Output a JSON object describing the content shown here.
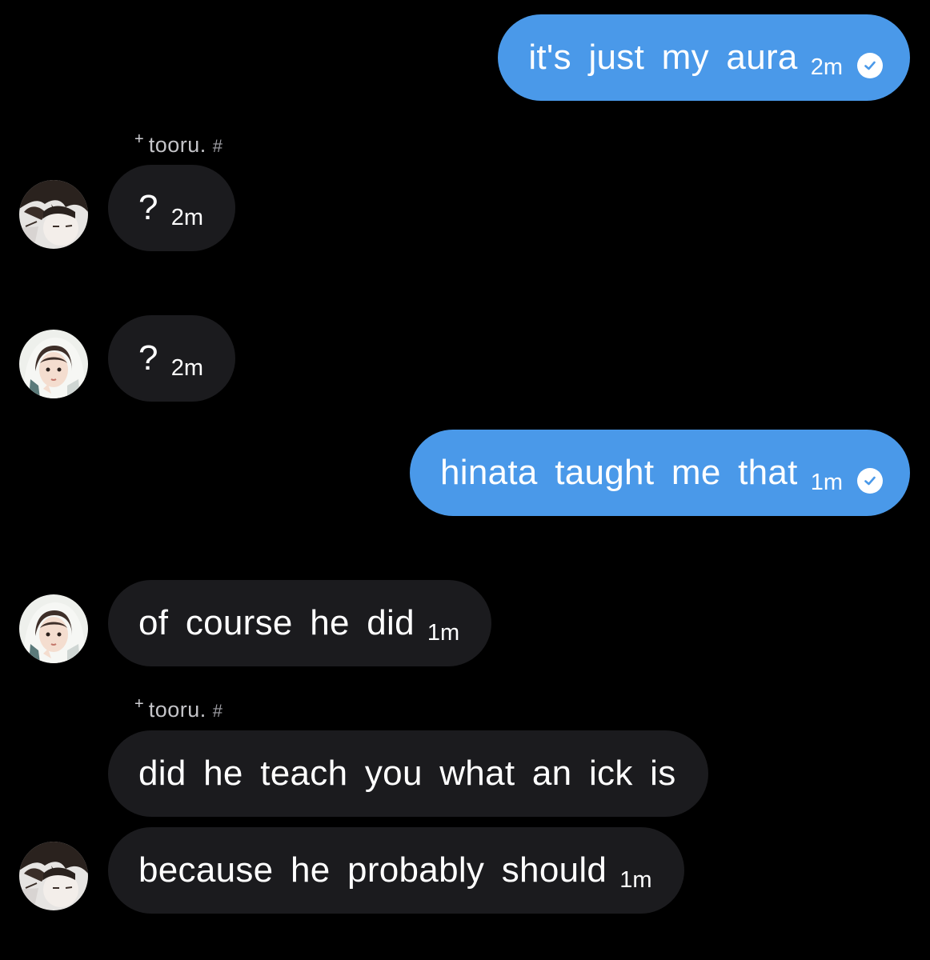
{
  "messages": [
    {
      "id": "m1",
      "direction": "outgoing",
      "text": "it's just my aura",
      "time": "2m",
      "read_icon": "check-circle-icon"
    },
    {
      "id": "m2",
      "direction": "incoming",
      "sender": {
        "name": "tooru.",
        "plus": "+",
        "tag": "#"
      },
      "avatar": "avatar-tooru",
      "text": "?",
      "time": "2m"
    },
    {
      "id": "m3",
      "direction": "incoming",
      "avatar": "avatar-hooded-girl",
      "text": "?",
      "time": "2m"
    },
    {
      "id": "m4",
      "direction": "outgoing",
      "text": "hinata taught me that",
      "time": "1m",
      "read_icon": "check-circle-icon"
    },
    {
      "id": "m5",
      "direction": "incoming",
      "avatar": "avatar-hooded-girl",
      "text": "of course he did",
      "time": "1m"
    },
    {
      "id": "m6",
      "direction": "incoming",
      "sender": {
        "name": "tooru.",
        "plus": "+",
        "tag": "#"
      },
      "text": "did he teach you what an ick is"
    },
    {
      "id": "m7",
      "direction": "incoming",
      "avatar": "avatar-tooru",
      "text": "because he probably should",
      "time": "1m"
    }
  ],
  "colors": {
    "background": "#000000",
    "outgoing_bubble": "#4a99e9",
    "incoming_bubble": "#1b1b1e",
    "sender_label": "#b9b9be"
  }
}
